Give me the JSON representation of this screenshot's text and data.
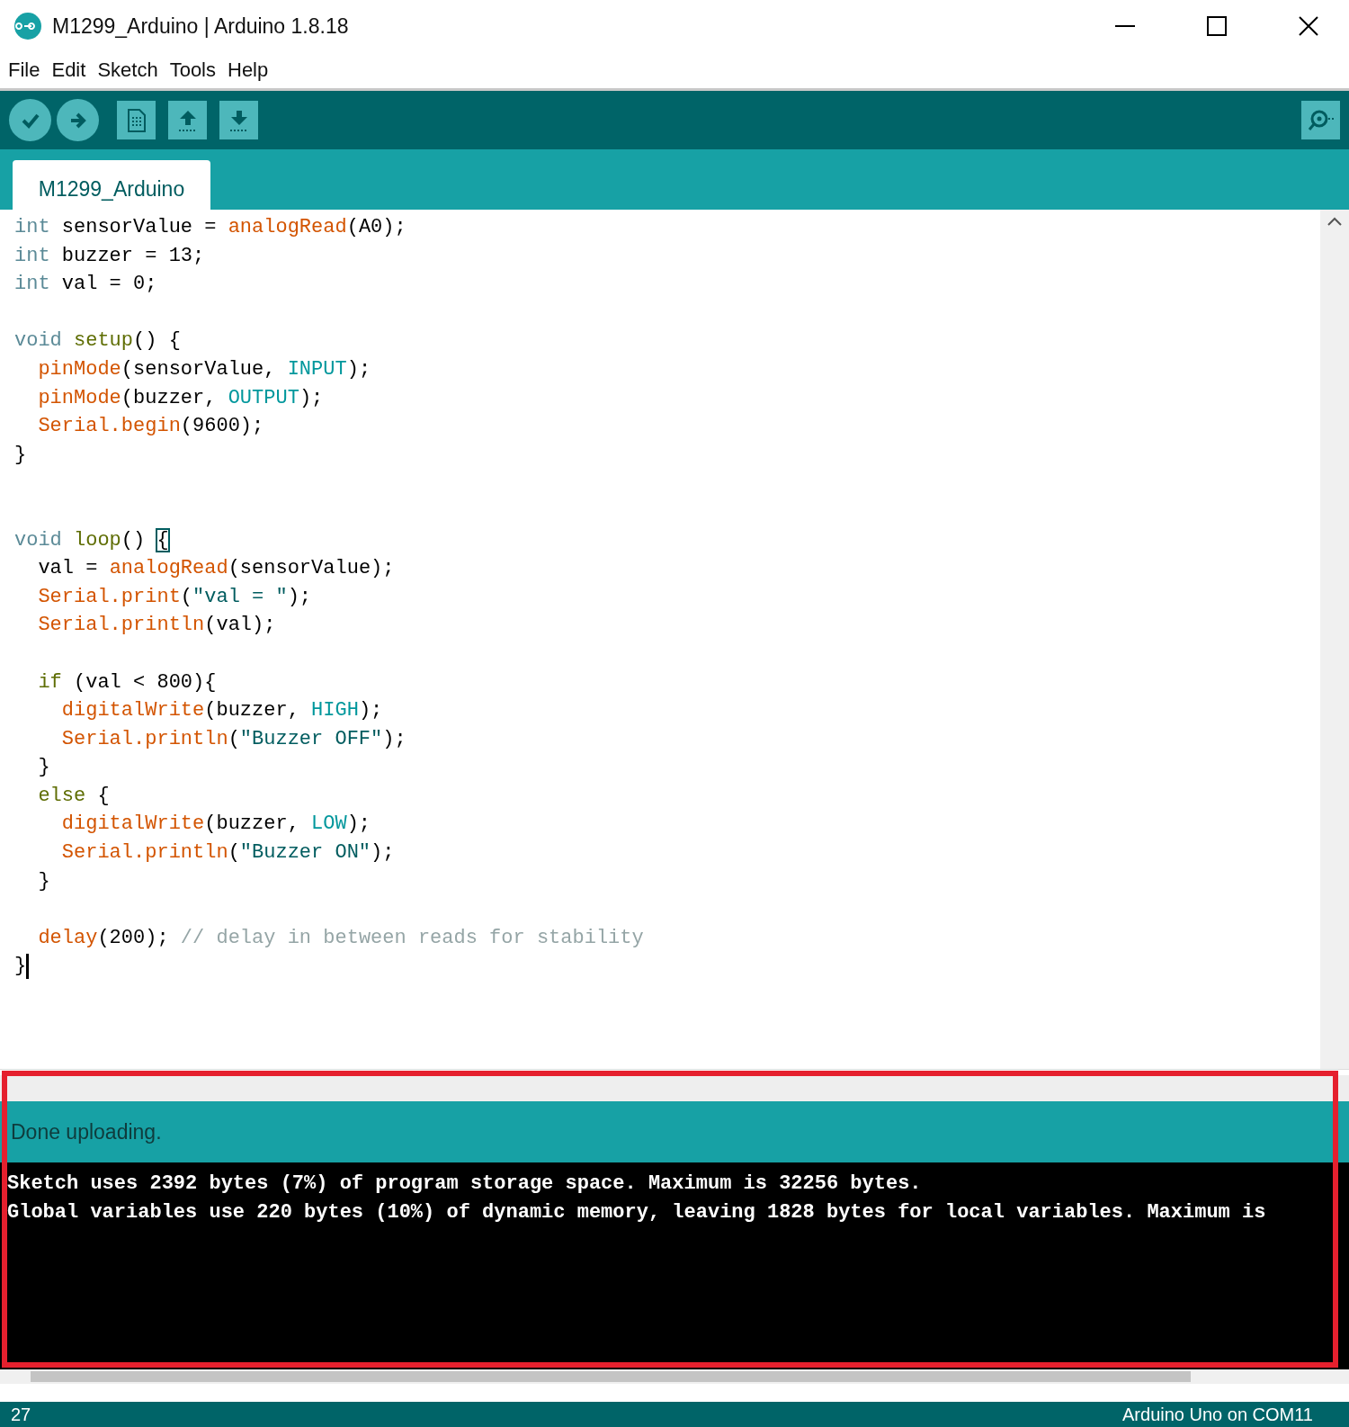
{
  "window": {
    "title": "M1299_Arduino | Arduino 1.8.18"
  },
  "menu": [
    "File",
    "Edit",
    "Sketch",
    "Tools",
    "Help"
  ],
  "tabs": [
    {
      "label": "M1299_Arduino",
      "selected": true
    }
  ],
  "editor": {
    "lines": [
      {
        "kind": "code",
        "cursor": false,
        "tokens": [
          {
            "kind": "type",
            "text": "int"
          },
          {
            "kind": "plain",
            "text": " sensorValue = "
          },
          {
            "kind": "func",
            "text": "analogRead"
          },
          {
            "kind": "plain",
            "text": "(A0);"
          }
        ]
      },
      {
        "kind": "code",
        "cursor": false,
        "tokens": [
          {
            "kind": "type",
            "text": "int"
          },
          {
            "kind": "plain",
            "text": " buzzer = 13;"
          }
        ]
      },
      {
        "kind": "code",
        "cursor": false,
        "tokens": [
          {
            "kind": "type",
            "text": "int"
          },
          {
            "kind": "plain",
            "text": " val = 0;"
          }
        ]
      },
      {
        "kind": "blank",
        "cursor": false
      },
      {
        "kind": "code",
        "cursor": false,
        "tokens": [
          {
            "kind": "type",
            "text": "void"
          },
          {
            "kind": "keyword",
            "text": " setup"
          },
          {
            "kind": "plain",
            "text": "() {"
          }
        ]
      },
      {
        "kind": "code",
        "cursor": false,
        "tokens": [
          {
            "kind": "func",
            "text": "  pinMode"
          },
          {
            "kind": "plain",
            "text": "(sensorValue, "
          },
          {
            "kind": "const",
            "text": "INPUT"
          },
          {
            "kind": "plain",
            "text": ");"
          }
        ]
      },
      {
        "kind": "code",
        "cursor": false,
        "tokens": [
          {
            "kind": "func",
            "text": "  pinMode"
          },
          {
            "kind": "plain",
            "text": "(buzzer, "
          },
          {
            "kind": "const",
            "text": "OUTPUT"
          },
          {
            "kind": "plain",
            "text": ");"
          }
        ]
      },
      {
        "kind": "code",
        "cursor": false,
        "tokens": [
          {
            "kind": "func",
            "text": "  Serial.begin"
          },
          {
            "kind": "plain",
            "text": "(9600);"
          }
        ]
      },
      {
        "kind": "code",
        "cursor": false,
        "tokens": [
          {
            "kind": "plain",
            "text": "}"
          }
        ]
      },
      {
        "kind": "blank",
        "cursor": false
      },
      {
        "kind": "blank",
        "cursor": false
      },
      {
        "kind": "code",
        "cursor": false,
        "tokens": [
          {
            "kind": "type",
            "text": "void"
          },
          {
            "kind": "keyword",
            "text": " loop"
          },
          {
            "kind": "plain",
            "text": "() "
          },
          {
            "kind": "match",
            "text": "{"
          }
        ]
      },
      {
        "kind": "code",
        "cursor": false,
        "tokens": [
          {
            "kind": "plain",
            "text": "  val = "
          },
          {
            "kind": "func",
            "text": "analogRead"
          },
          {
            "kind": "plain",
            "text": "(sensorValue);"
          }
        ]
      },
      {
        "kind": "code",
        "cursor": false,
        "tokens": [
          {
            "kind": "func",
            "text": "  Serial.print"
          },
          {
            "kind": "plain",
            "text": "("
          },
          {
            "kind": "string",
            "text": "\"val = \""
          },
          {
            "kind": "plain",
            "text": ");"
          }
        ]
      },
      {
        "kind": "code",
        "cursor": false,
        "tokens": [
          {
            "kind": "func",
            "text": "  Serial.println"
          },
          {
            "kind": "plain",
            "text": "(val);"
          }
        ]
      },
      {
        "kind": "blank",
        "cursor": false
      },
      {
        "kind": "code",
        "cursor": false,
        "tokens": [
          {
            "kind": "keyword",
            "text": "  if"
          },
          {
            "kind": "plain",
            "text": " (val < 800){"
          }
        ]
      },
      {
        "kind": "code",
        "cursor": false,
        "tokens": [
          {
            "kind": "func",
            "text": "    digitalWrite"
          },
          {
            "kind": "plain",
            "text": "(buzzer, "
          },
          {
            "kind": "const",
            "text": "HIGH"
          },
          {
            "kind": "plain",
            "text": ");"
          }
        ]
      },
      {
        "kind": "code",
        "cursor": false,
        "tokens": [
          {
            "kind": "func",
            "text": "    Serial.println"
          },
          {
            "kind": "plain",
            "text": "("
          },
          {
            "kind": "string",
            "text": "\"Buzzer OFF\""
          },
          {
            "kind": "plain",
            "text": ");"
          }
        ]
      },
      {
        "kind": "code",
        "cursor": false,
        "tokens": [
          {
            "kind": "plain",
            "text": "  }"
          }
        ]
      },
      {
        "kind": "code",
        "cursor": false,
        "tokens": [
          {
            "kind": "keyword",
            "text": "  else"
          },
          {
            "kind": "plain",
            "text": " {"
          }
        ]
      },
      {
        "kind": "code",
        "cursor": false,
        "tokens": [
          {
            "kind": "func",
            "text": "    digitalWrite"
          },
          {
            "kind": "plain",
            "text": "(buzzer, "
          },
          {
            "kind": "const",
            "text": "LOW"
          },
          {
            "kind": "plain",
            "text": ");"
          }
        ]
      },
      {
        "kind": "code",
        "cursor": false,
        "tokens": [
          {
            "kind": "func",
            "text": "    Serial.println"
          },
          {
            "kind": "plain",
            "text": "("
          },
          {
            "kind": "string",
            "text": "\"Buzzer ON\""
          },
          {
            "kind": "plain",
            "text": ");"
          }
        ]
      },
      {
        "kind": "code",
        "cursor": false,
        "tokens": [
          {
            "kind": "plain",
            "text": "  }"
          }
        ]
      },
      {
        "kind": "blank",
        "cursor": false
      },
      {
        "kind": "code",
        "cursor": false,
        "tokens": [
          {
            "kind": "func",
            "text": "  delay"
          },
          {
            "kind": "plain",
            "text": "(200); "
          },
          {
            "kind": "comment",
            "text": "// delay in between reads for stability"
          }
        ]
      },
      {
        "kind": "code",
        "cursor": true,
        "tokens": [
          {
            "kind": "plain",
            "text": "}"
          }
        ]
      }
    ]
  },
  "message": "Done uploading.",
  "console": [
    "Sketch uses 2392 bytes (7%) of program storage space. Maximum is 32256 bytes.",
    "Global variables use 220 bytes (10%) of dynamic memory, leaving 1828 bytes for local variables. Maximum is"
  ],
  "status_bar": {
    "line": "27",
    "board": "Arduino Uno on COM11"
  }
}
